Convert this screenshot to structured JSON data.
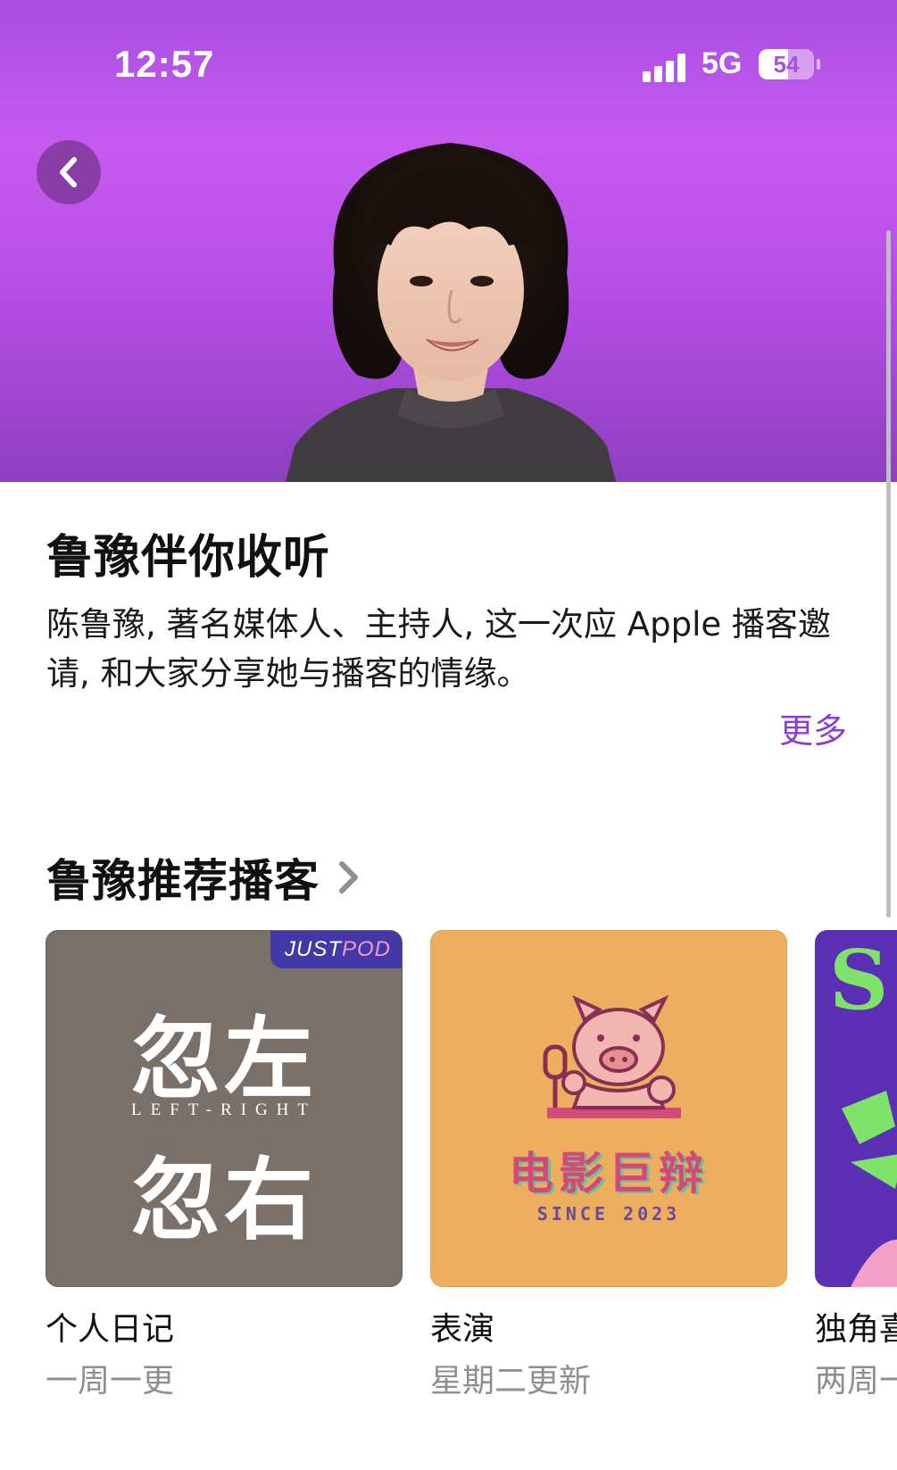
{
  "status_bar": {
    "time": "12:57",
    "network": "5G",
    "battery": "54",
    "battery_level_percent": 54,
    "signal_icon": "cellular-signal-icon"
  },
  "hero": {
    "back_icon": "chevron-left-icon",
    "background_colors": [
      "#a94fe0",
      "#c65af0",
      "#8d3fbf"
    ]
  },
  "page": {
    "title": "鲁豫伴你收听",
    "description": "陈鲁豫, 著名媒体人、主持人, 这一次应 Apple 播客邀请, 和大家分享她与播客的情缘。",
    "more_label": "更多",
    "accent_color": "#8a3fd4"
  },
  "section": {
    "title": "鲁豫推荐播客",
    "chevron_icon": "chevron-right-icon"
  },
  "podcasts": [
    {
      "genre": "个人日记",
      "frequency": "一周一更",
      "cover": {
        "badge_just": "JUST",
        "badge_pod": "POD",
        "line1": "忽左",
        "middle": "LEFT-RIGHT",
        "line2": "忽右"
      }
    },
    {
      "genre": "表演",
      "frequency": "星期二更新",
      "cover": {
        "title": "电影巨辩",
        "since": "SINCE 2023",
        "mascot_icon": "pig-microphone-icon"
      }
    },
    {
      "genre": "独角喜",
      "frequency": "两周一",
      "cover": {
        "glyph": "S",
        "ornament_icon": "abstract-art-icon"
      }
    }
  ]
}
